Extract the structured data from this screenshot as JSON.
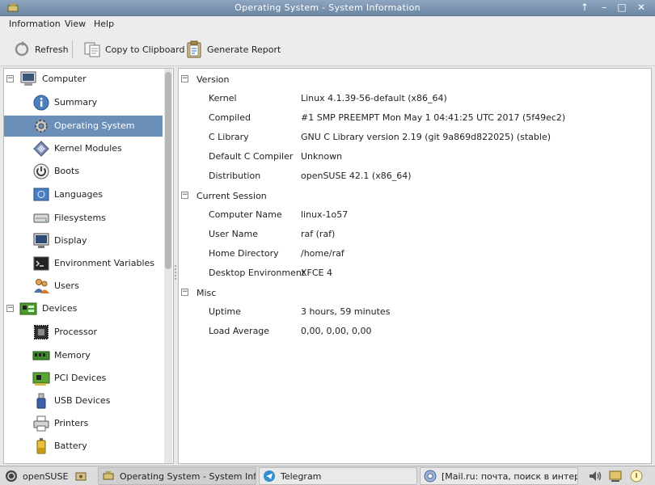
{
  "window": {
    "title": "Operating System - System Information"
  },
  "menu": [
    "Information",
    "View",
    "Help"
  ],
  "toolbar": {
    "refresh": "Refresh",
    "copy": "Copy to Clipboard",
    "report": "Generate Report"
  },
  "tree": [
    {
      "label": "Computer",
      "icon": "computer-icon",
      "level": 0
    },
    {
      "label": "Summary",
      "icon": "info-icon",
      "level": 1
    },
    {
      "label": "Operating System",
      "icon": "gear-icon",
      "level": 1,
      "selected": true
    },
    {
      "label": "Kernel Modules",
      "icon": "module-icon",
      "level": 1
    },
    {
      "label": "Boots",
      "icon": "power-icon",
      "level": 1
    },
    {
      "label": "Languages",
      "icon": "flag-icon",
      "level": 1
    },
    {
      "label": "Filesystems",
      "icon": "drive-icon",
      "level": 1
    },
    {
      "label": "Display",
      "icon": "monitor-icon",
      "level": 1
    },
    {
      "label": "Environment Variables",
      "icon": "terminal-icon",
      "level": 1
    },
    {
      "label": "Users",
      "icon": "users-icon",
      "level": 1
    },
    {
      "label": "Devices",
      "icon": "board-icon",
      "level": 0
    },
    {
      "label": "Processor",
      "icon": "cpu-icon",
      "level": 1
    },
    {
      "label": "Memory",
      "icon": "memory-icon",
      "level": 1
    },
    {
      "label": "PCI Devices",
      "icon": "pci-icon",
      "level": 1
    },
    {
      "label": "USB Devices",
      "icon": "usb-icon",
      "level": 1
    },
    {
      "label": "Printers",
      "icon": "printer-icon",
      "level": 1
    },
    {
      "label": "Battery",
      "icon": "battery-icon",
      "level": 1
    }
  ],
  "sections": [
    {
      "title": "Version",
      "rows": [
        {
          "key": "Kernel",
          "value": "Linux 4.1.39-56-default (x86_64)"
        },
        {
          "key": "Compiled",
          "value": "#1 SMP PREEMPT Mon May 1 04:41:25 UTC 2017 (5f49ec2)"
        },
        {
          "key": "C Library",
          "value": "GNU C Library version 2.19 (git 9a869d822025) (stable)"
        },
        {
          "key": "Default C Compiler",
          "value": "Unknown"
        },
        {
          "key": "Distribution",
          "value": "openSUSE 42.1 (x86_64)"
        }
      ]
    },
    {
      "title": "Current Session",
      "rows": [
        {
          "key": "Computer Name",
          "value": "linux-1o57"
        },
        {
          "key": "User Name",
          "value": "raf (raf)"
        },
        {
          "key": "Home Directory",
          "value": "/home/raf"
        },
        {
          "key": "Desktop Environment",
          "value": "XFCE 4"
        }
      ]
    },
    {
      "title": "Misc",
      "rows": [
        {
          "key": "Uptime",
          "value": "3 hours, 59 minutes"
        },
        {
          "key": "Load Average",
          "value": "0,00, 0,00, 0,00"
        }
      ]
    }
  ],
  "taskbar": {
    "start": "openSUSE",
    "tasks": [
      {
        "label": "Operating System - System Infor...",
        "active": true
      },
      {
        "label": "Telegram",
        "active": false
      },
      {
        "label": "[Mail.ru: почта, поиск в интерн...",
        "active": false
      }
    ]
  },
  "colors": {
    "selection": "#6a8fb9",
    "titlebar": "#7891ad"
  }
}
